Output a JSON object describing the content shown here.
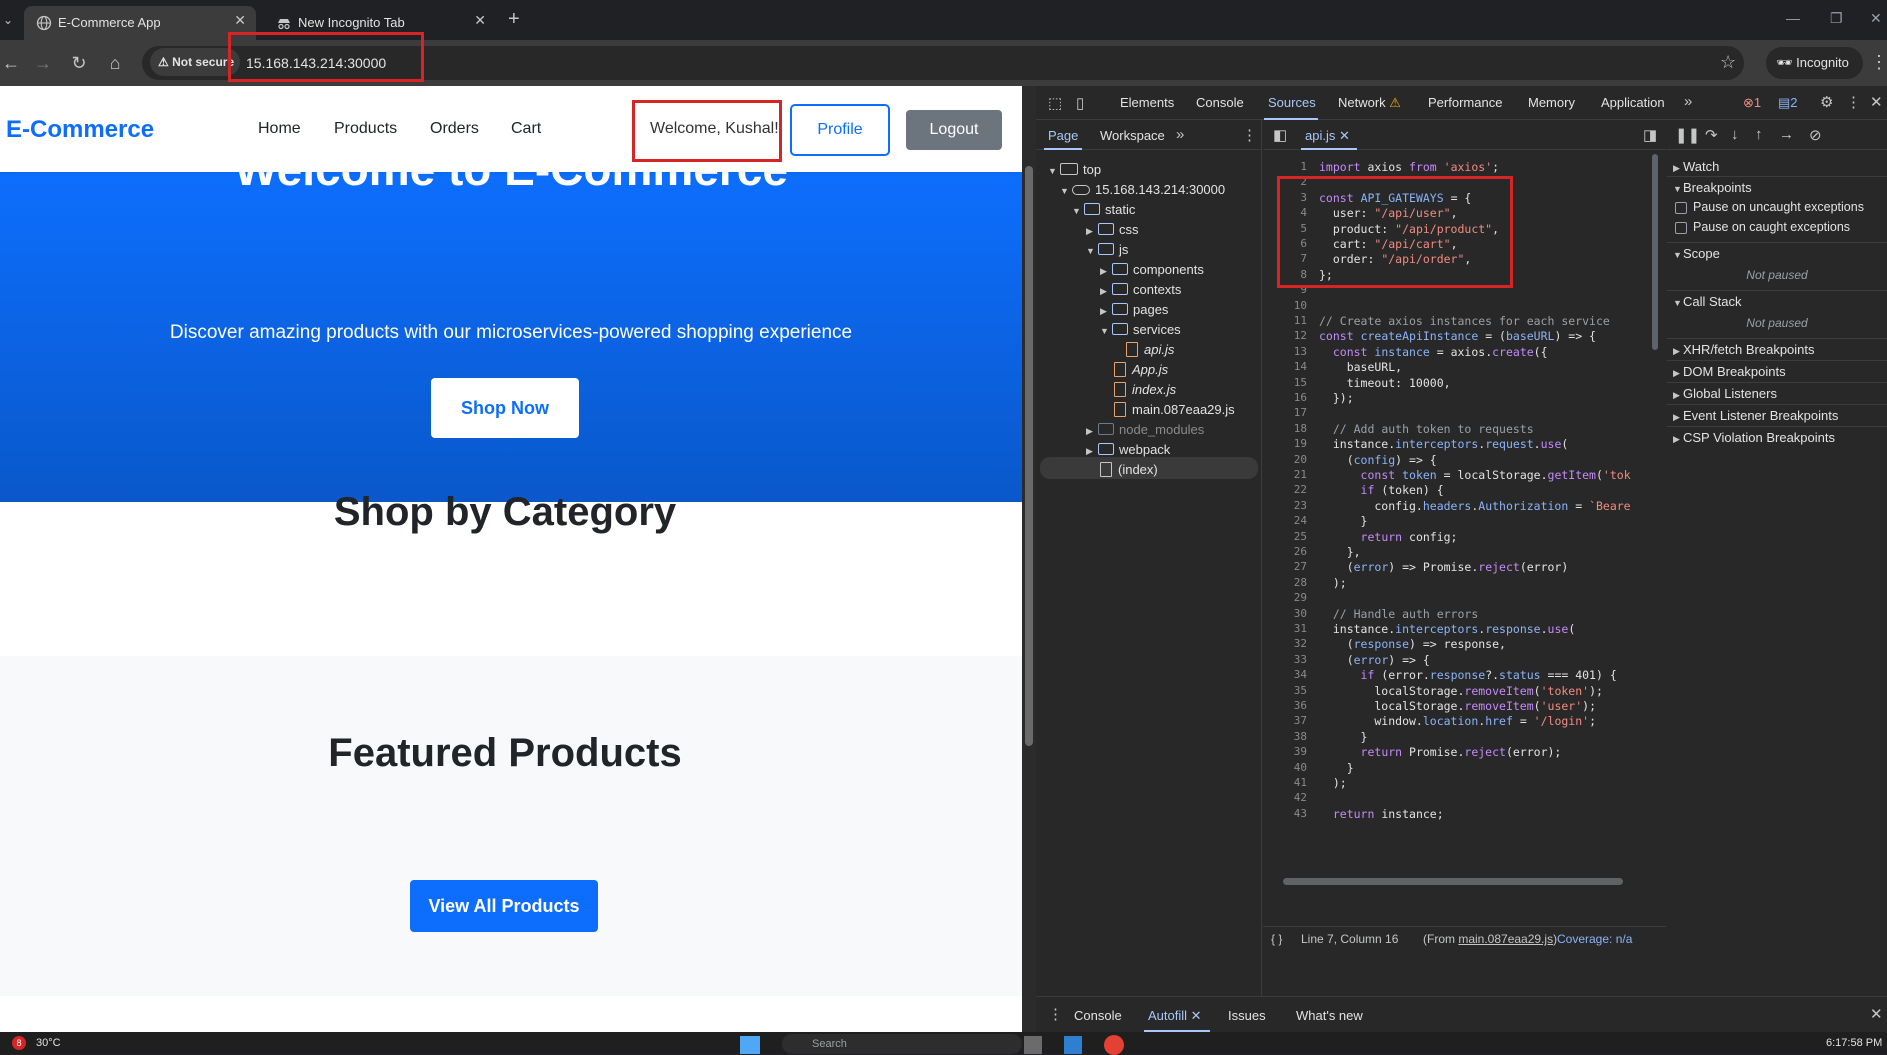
{
  "browser": {
    "tabs": [
      {
        "title": "E-Commerce App",
        "active": true
      },
      {
        "title": "New Incognito Tab",
        "active": false
      }
    ],
    "security_label": "Not secure",
    "url": "15.168.143.214:30000",
    "profile_label": "Incognito"
  },
  "site": {
    "brand": "E-Commerce",
    "nav": [
      "Home",
      "Products",
      "Orders",
      "Cart"
    ],
    "welcome": "Welcome, Kushal!",
    "profile_button": "Profile",
    "logout_button": "Logout",
    "hero": {
      "title": "Welcome to E-Commerce",
      "subtitle": "Discover amazing products with our microservices-powered shopping experience",
      "cta": "Shop Now"
    },
    "category_heading": "Shop by Category",
    "featured_heading": "Featured Products",
    "view_all_button": "View All Products"
  },
  "devtools": {
    "tabs": [
      "Elements",
      "Console",
      "Sources",
      "Network",
      "Performance",
      "Memory",
      "Application"
    ],
    "selected_tab": "Sources",
    "error_count": "1",
    "message_count": "2",
    "navigator_tabs": [
      "Page",
      "Workspace"
    ],
    "tree": {
      "top": "top",
      "origin": "15.168.143.214:30000",
      "static": "static",
      "css": "css",
      "js": "js",
      "components": "components",
      "contexts": "contexts",
      "pages": "pages",
      "services": "services",
      "api": "api.js",
      "app": "App.js",
      "index_js": "index.js",
      "main": "main.087eaa29.js",
      "node_modules": "node_modules",
      "webpack": "webpack",
      "index": "(index)"
    },
    "open_file": "api.js",
    "status_line": "Line 7, Column 16",
    "status_from_prefix": "(From ",
    "status_from_file": "main.087eaa29.js",
    "status_from_suffix": ")",
    "coverage": "Coverage: n/a",
    "debugger": {
      "watch": "Watch",
      "breakpoints": "Breakpoints",
      "pause_uncaught": "Pause on uncaught exceptions",
      "pause_caught": "Pause on caught exceptions",
      "scope": "Scope",
      "not_paused": "Not paused",
      "call_stack": "Call Stack",
      "xhr": "XHR/fetch Breakpoints",
      "dom": "DOM Breakpoints",
      "global": "Global Listeners",
      "event": "Event Listener Breakpoints",
      "csp": "CSP Violation Breakpoints"
    },
    "drawer_tabs": [
      "Console",
      "Autofill",
      "Issues",
      "What's new"
    ],
    "drawer_selected": "Autofill"
  },
  "taskbar": {
    "temperature": "30°C",
    "notifications": "8",
    "search_placeholder": "Search",
    "time": "6:17:58 PM"
  },
  "colors": {
    "primary": "#0d6efd",
    "highlight_box": "#d72424",
    "devtools_bg": "#282828"
  }
}
